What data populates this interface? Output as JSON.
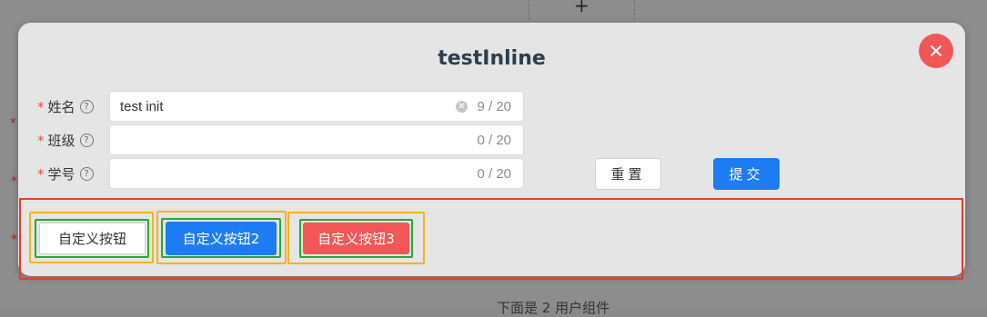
{
  "background": {
    "plus_glyph": "+",
    "required_mark": "*",
    "footer_text": "下面是 2 用户组件"
  },
  "dialog": {
    "title": "testInline",
    "close_icon": "close-icon"
  },
  "form": {
    "fields": [
      {
        "label": "姓名",
        "required": "*",
        "help": "?",
        "value": "test init",
        "placeholder": "",
        "count": "9 / 20",
        "has_clear": true
      },
      {
        "label": "班级",
        "required": "*",
        "help": "?",
        "value": "",
        "placeholder": "",
        "count": "0 / 20",
        "has_clear": false
      },
      {
        "label": "学号",
        "required": "*",
        "help": "?",
        "value": "",
        "placeholder": "",
        "count": "0 / 20",
        "has_clear": false
      }
    ],
    "reset_label": "重置",
    "submit_label": "提交"
  },
  "custom_buttons": [
    {
      "label": "自定义按钮",
      "color": "#ffffff"
    },
    {
      "label": "自定义按钮2",
      "color": "#1d7cf2"
    },
    {
      "label": "自定义按钮3",
      "color": "#f25656"
    }
  ],
  "colors": {
    "accent": "#1d7cf2",
    "danger": "#f25656",
    "highlight_red": "#e83a2e",
    "highlight_yellow": "#f4b41a",
    "highlight_green": "#2aa832"
  }
}
